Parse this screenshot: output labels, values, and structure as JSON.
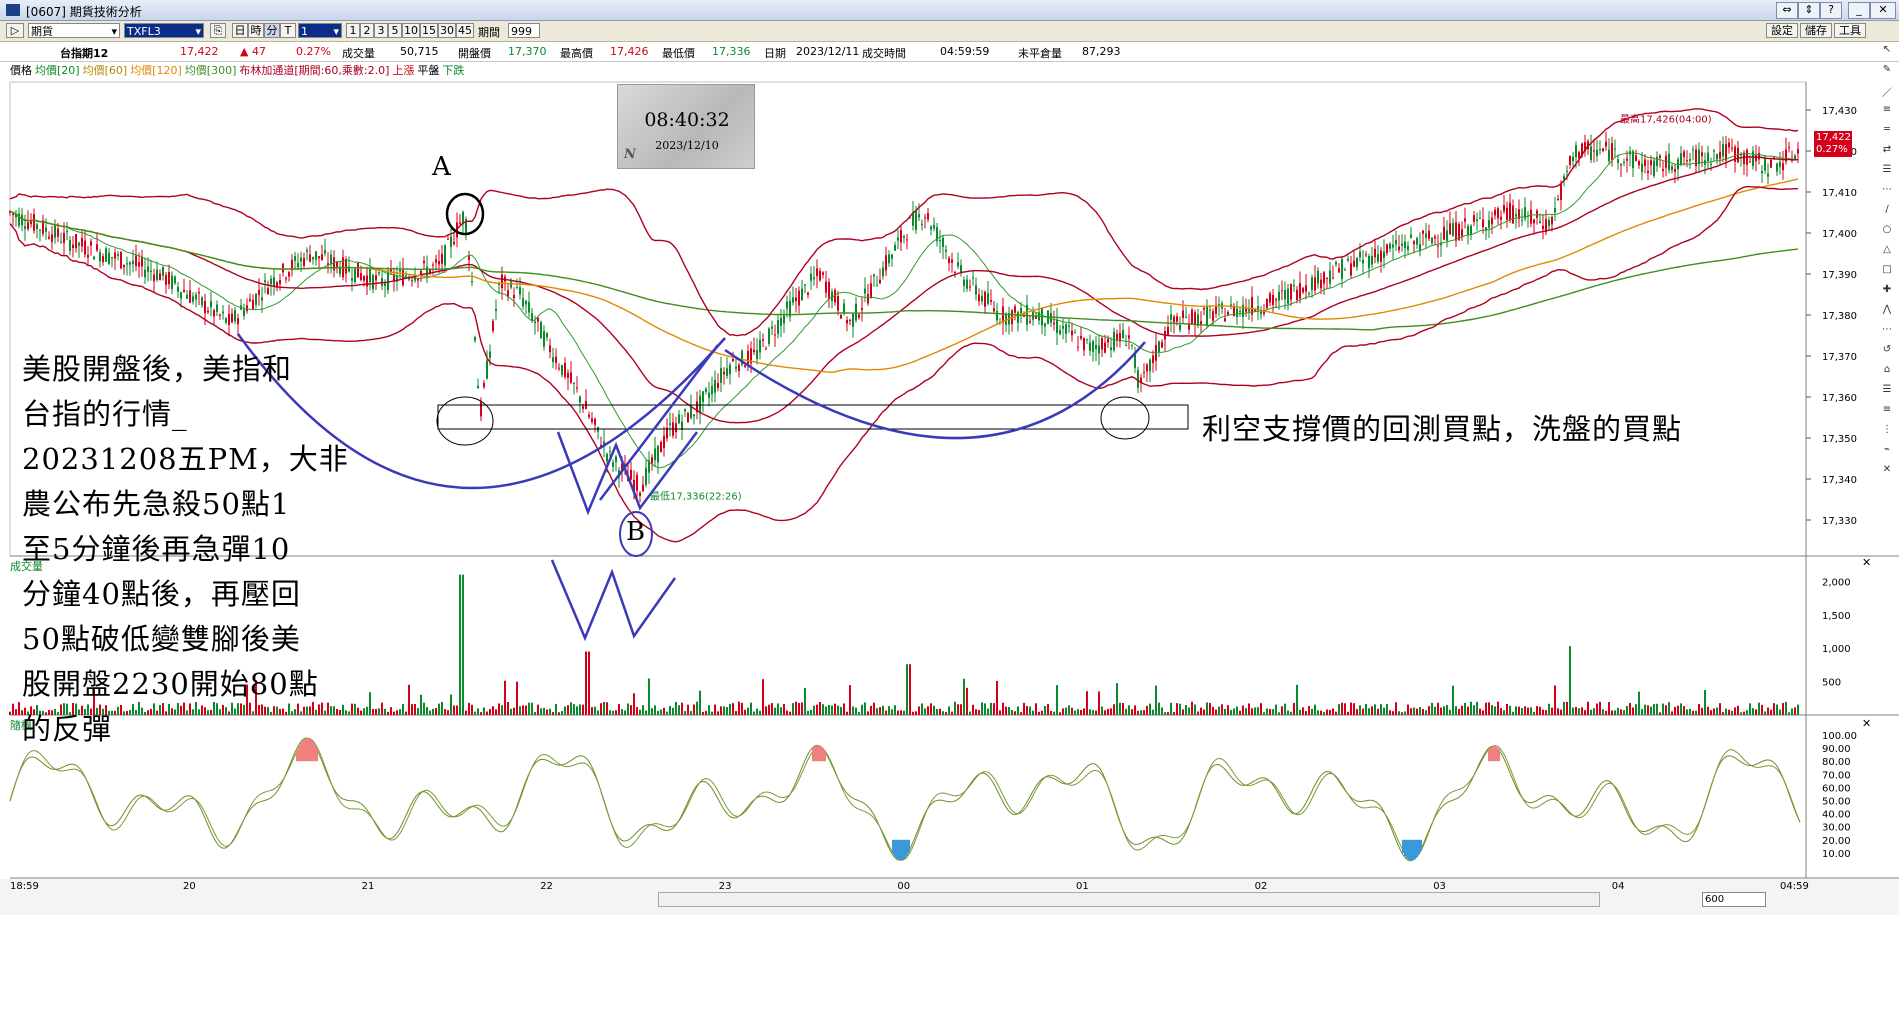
{
  "window": {
    "title": "[0607] 期貨技術分析",
    "buttons": [
      "⇔",
      "⇕",
      "?",
      "_",
      "□",
      "✕"
    ]
  },
  "toolbar": {
    "market": "期貨",
    "symbol": "TXFL3",
    "range_buttons": [
      "日",
      "時",
      "分",
      "T"
    ],
    "interval_value": "1",
    "minute_buttons": [
      "1",
      "2",
      "3",
      "5",
      "10",
      "15",
      "30",
      "45"
    ],
    "period_label": "期間",
    "period_value": "999",
    "settings": "設定",
    "save": "儲存",
    "tools": "工具"
  },
  "quote": {
    "name": "台指期12",
    "price": "17,422",
    "change": "▲ 47",
    "change_pct": "0.27%",
    "volume_label": "成交量",
    "volume": "50,715",
    "open_label": "開盤價",
    "open": "17,370",
    "high_label": "最高價",
    "high": "17,426",
    "low_label": "最低價",
    "low": "17,336",
    "date_label": "日期",
    "date": "2023/12/11",
    "time_label": "成交時間",
    "time": "04:59:59",
    "oi_label": "未平倉量",
    "oi": "87,293"
  },
  "legend": {
    "items": [
      {
        "text": "價格",
        "color": "#000000"
      },
      {
        "text": "均價[20]",
        "color": "#0a8a2a"
      },
      {
        "text": "均價[60]",
        "color": "#b8860b"
      },
      {
        "text": "均價[120]",
        "color": "#e08a00"
      },
      {
        "text": "均價[300]",
        "color": "#3d8f1f"
      },
      {
        "text": "布林加通道[期間:60,乘數:2.0]",
        "color": "#b00020"
      },
      {
        "text": "上漲",
        "color": "#d4001a"
      },
      {
        "text": "平盤",
        "color": "#000000"
      },
      {
        "text": "下跌",
        "color": "#0a8a2a"
      }
    ]
  },
  "clock": {
    "time": "08:40:32",
    "date": "2023/12/10",
    "logo": "N"
  },
  "price_axis": [
    "17,430",
    "17,420",
    "17,410",
    "17,400",
    "17,390",
    "17,380",
    "17,370",
    "17,360",
    "17,350",
    "17,340",
    "17,330"
  ],
  "last_price_tag": {
    "price": "17,422",
    "pct": "0.27%"
  },
  "high_marker": "最高17,426(04:00)",
  "low_marker": "最低17,336(22:26)",
  "volume_panel": {
    "label": "成交量",
    "axis": [
      "2,000",
      "1,500",
      "1,000",
      "500"
    ]
  },
  "kd_panel": {
    "label": "隨機",
    "axis": [
      "100.00",
      "90.00",
      "80.00",
      "70.00",
      "60.00",
      "50.00",
      "40.00",
      "30.00",
      "20.00",
      "10.00"
    ]
  },
  "time_axis": [
    "18:59",
    "20",
    "21",
    "22",
    "23",
    "00",
    "01",
    "02",
    "03",
    "04",
    "04:59"
  ],
  "bottom_bar": {
    "zoom": "600"
  },
  "annotations": {
    "label_a": "A",
    "label_b": "B",
    "right_note": "利空支撐價的回測買點，洗盤的買點",
    "left_note": [
      "美股開盤後，美指和",
      "台指的行情_",
      "20231208五PM，大非",
      "農公布先急殺50點1",
      "至5分鐘後再急彈10",
      "分鐘40點後，再壓回",
      "50點破低變雙腳後美",
      "股開盤2230開始80點",
      "的反彈"
    ]
  },
  "colors": {
    "up": "#d4001a",
    "down": "#0a8a2a",
    "boll": "#b00020",
    "ma20": "#2e9a2e",
    "ma60": "#e08a00",
    "ma300": "#3d8f1f",
    "annotation_blue": "#3a3ab8"
  }
}
